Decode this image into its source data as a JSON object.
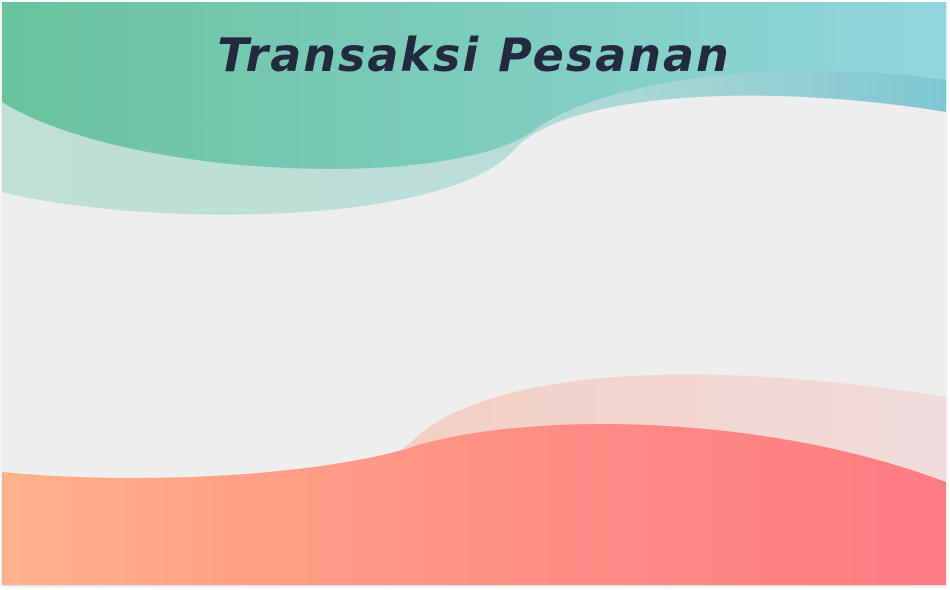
{
  "slide": {
    "title": "Transaksi Pesanan"
  },
  "colors": {
    "background": "#eeeeee",
    "top_wave_start": "#6cc5a3",
    "top_wave_end": "#8fd3dd",
    "bottom_wave_start": "#ffb38a",
    "bottom_wave_end": "#ff7a82",
    "title_text": "#232a3f"
  }
}
